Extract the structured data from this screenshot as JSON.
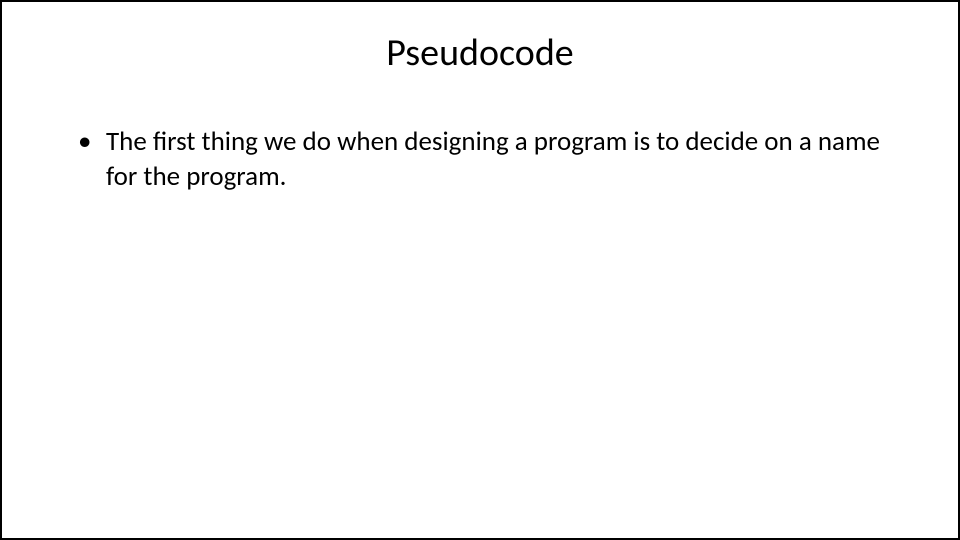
{
  "slide": {
    "title": "Pseudocode",
    "bullets": [
      "The first thing we do when designing a program is to decide on a name for the program."
    ]
  }
}
